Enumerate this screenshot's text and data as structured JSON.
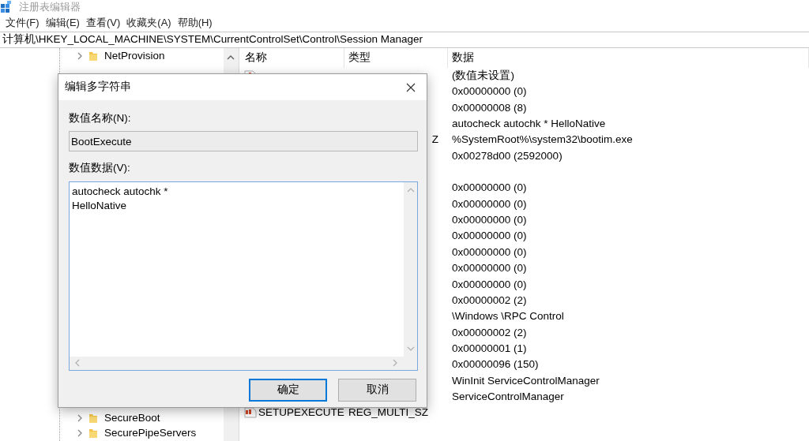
{
  "window": {
    "title": "注册表编辑器"
  },
  "menu": [
    "文件(F)",
    "编辑(E)",
    "查看(V)",
    "收藏夹(A)",
    "帮助(H)"
  ],
  "address": "计算机\\HKEY_LOCAL_MACHINE\\SYSTEM\\CurrentControlSet\\Control\\Session Manager",
  "tree": {
    "top_items": [
      {
        "label": "NetProvision",
        "expanded": false
      }
    ],
    "bottom_items": [
      {
        "label": "SecureBoot",
        "expanded": false
      },
      {
        "label": "SecurePipeServers",
        "expanded": false
      }
    ]
  },
  "values": {
    "columns": [
      "名称",
      "类型",
      "数据"
    ],
    "rows": [
      {
        "data": "(数值未设置)",
        "kind": "string"
      },
      {
        "data": "0x00000000 (0)"
      },
      {
        "data": "0x00000008 (8)"
      },
      {
        "data": "autocheck autochk * HelloNative"
      },
      {
        "type": "Z",
        "data": "%SystemRoot%\\system32\\bootim.exe"
      },
      {
        "data": "0x00278d00 (2592000)"
      },
      {},
      {
        "data": "0x00000000 (0)"
      },
      {
        "data": "0x00000000 (0)"
      },
      {
        "data": "0x00000000 (0)"
      },
      {
        "data": "0x00000000 (0)"
      },
      {
        "data": "0x00000000 (0)"
      },
      {
        "data": "0x00000000 (0)"
      },
      {
        "data": "0x00000000 (0)"
      },
      {
        "data": "0x00000002 (2)"
      },
      {
        "data": "\\Windows \\RPC Control"
      },
      {
        "data": "0x00000002 (2)"
      },
      {
        "data": "0x00000001 (1)"
      },
      {
        "data": "0x00000096 (150)"
      },
      {
        "data": "WinInit ServiceControlManager"
      },
      {
        "data": "ServiceControlManager"
      },
      {
        "name": "SETUPEXECUTE",
        "type": "REG_MULTI_SZ",
        "kind": "string"
      }
    ]
  },
  "dialog": {
    "title": "编辑多字符串",
    "name_label": "数值名称(N):",
    "name_value": "BootExecute",
    "data_label": "数值数据(V):",
    "data_value": "autocheck autochk *\nHelloNative",
    "buttons": [
      {
        "label": "确定",
        "default": true
      },
      {
        "label": "取消",
        "default": false
      }
    ]
  }
}
